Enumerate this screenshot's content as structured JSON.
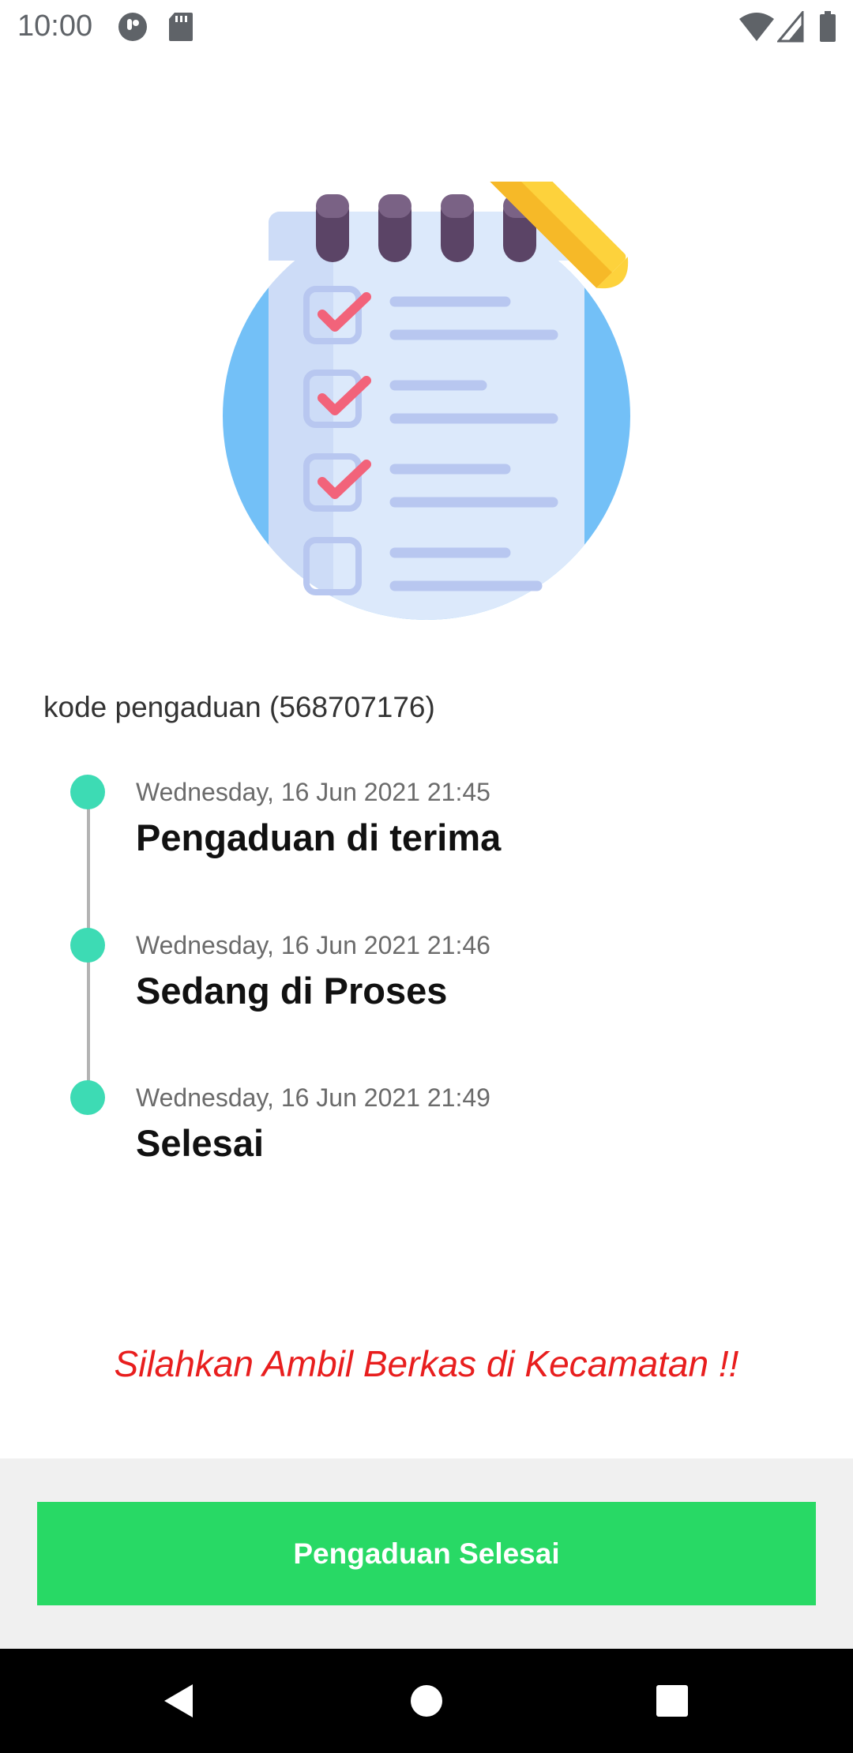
{
  "status_bar": {
    "time": "10:00",
    "icons": [
      "app-notification-icon",
      "sd-card-icon",
      "wifi-icon",
      "signal-icon",
      "battery-icon"
    ]
  },
  "illustration": {
    "icon": "checklist-clipboard-pencil-icon"
  },
  "complaint": {
    "code_label": "kode pengaduan (568707176)"
  },
  "timeline": [
    {
      "date": "Wednesday, 16 Jun 2021 21:45",
      "status": "Pengaduan di terima"
    },
    {
      "date": "Wednesday, 16 Jun 2021 21:46",
      "status": "Sedang di Proses"
    },
    {
      "date": "Wednesday, 16 Jun 2021 21:49",
      "status": "Selesai"
    }
  ],
  "notice": {
    "text": "Silahkan Ambil Berkas di Kecamatan !!"
  },
  "action": {
    "button_label": "Pengaduan Selesai"
  },
  "nav_bar": {
    "icons": [
      "back-icon",
      "home-icon",
      "recents-icon"
    ]
  },
  "colors": {
    "accent_green": "#28d965",
    "timeline_dot": "#3ddbb4",
    "notice_red": "#e81e1e"
  }
}
